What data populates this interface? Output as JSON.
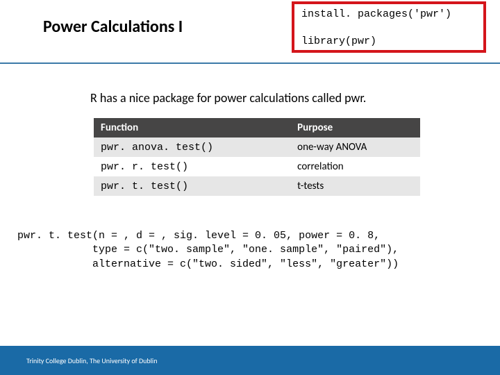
{
  "header": {
    "title": "Power Calculations I",
    "code_line1": "install. packages('pwr')",
    "code_line2": "library(pwr)"
  },
  "intro": "R has a nice package for power calculations called pwr.",
  "table": {
    "header_function": "Function",
    "header_purpose": "Purpose",
    "rows": [
      {
        "fn": "pwr. anova. test()",
        "purpose": "one-way ANOVA"
      },
      {
        "fn": "pwr. r. test()",
        "purpose": "correlation"
      },
      {
        "fn": "pwr. t. test()",
        "purpose": "t-tests"
      }
    ]
  },
  "code_example": "pwr. t. test(n = , d = , sig. level = 0. 05, power = 0. 8,\n            type = c(\"two. sample\", \"one. sample\", \"paired\"),\n            alternative = c(\"two. sided\", \"less\", \"greater\"))",
  "footer": "Trinity College Dublin, The University of Dublin"
}
